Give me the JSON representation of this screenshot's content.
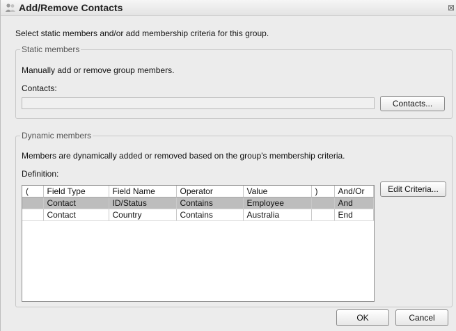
{
  "window": {
    "title": "Add/Remove Contacts",
    "close_glyph": "⊠",
    "icon": "people-icon"
  },
  "intro_text": "Select static members and/or add membership criteria for this group.",
  "static_members": {
    "legend": "Static members",
    "description": "Manually add or remove group members.",
    "contacts_label": "Contacts:",
    "contacts_value": "",
    "contacts_button": "Contacts..."
  },
  "dynamic_members": {
    "legend": "Dynamic members",
    "description": "Members are dynamically added or removed based on the group's membership criteria.",
    "definition_label": "Definition:",
    "edit_criteria_button": "Edit Criteria...",
    "columns": [
      "(",
      "Field Type",
      "Field Name",
      "Operator",
      "Value",
      ")",
      "And/Or"
    ],
    "rows": [
      [
        "",
        "Contact",
        "ID/Status",
        "Contains",
        "Employee",
        "",
        "And"
      ],
      [
        "",
        "Contact",
        "Country",
        "Contains",
        "Australia",
        "",
        "End"
      ]
    ],
    "selected_row": 0
  },
  "footer": {
    "ok_button": "OK",
    "cancel_button": "Cancel"
  },
  "colors": {
    "dialog_bg": "#ececec",
    "selected_row": "#bdbdbd"
  }
}
